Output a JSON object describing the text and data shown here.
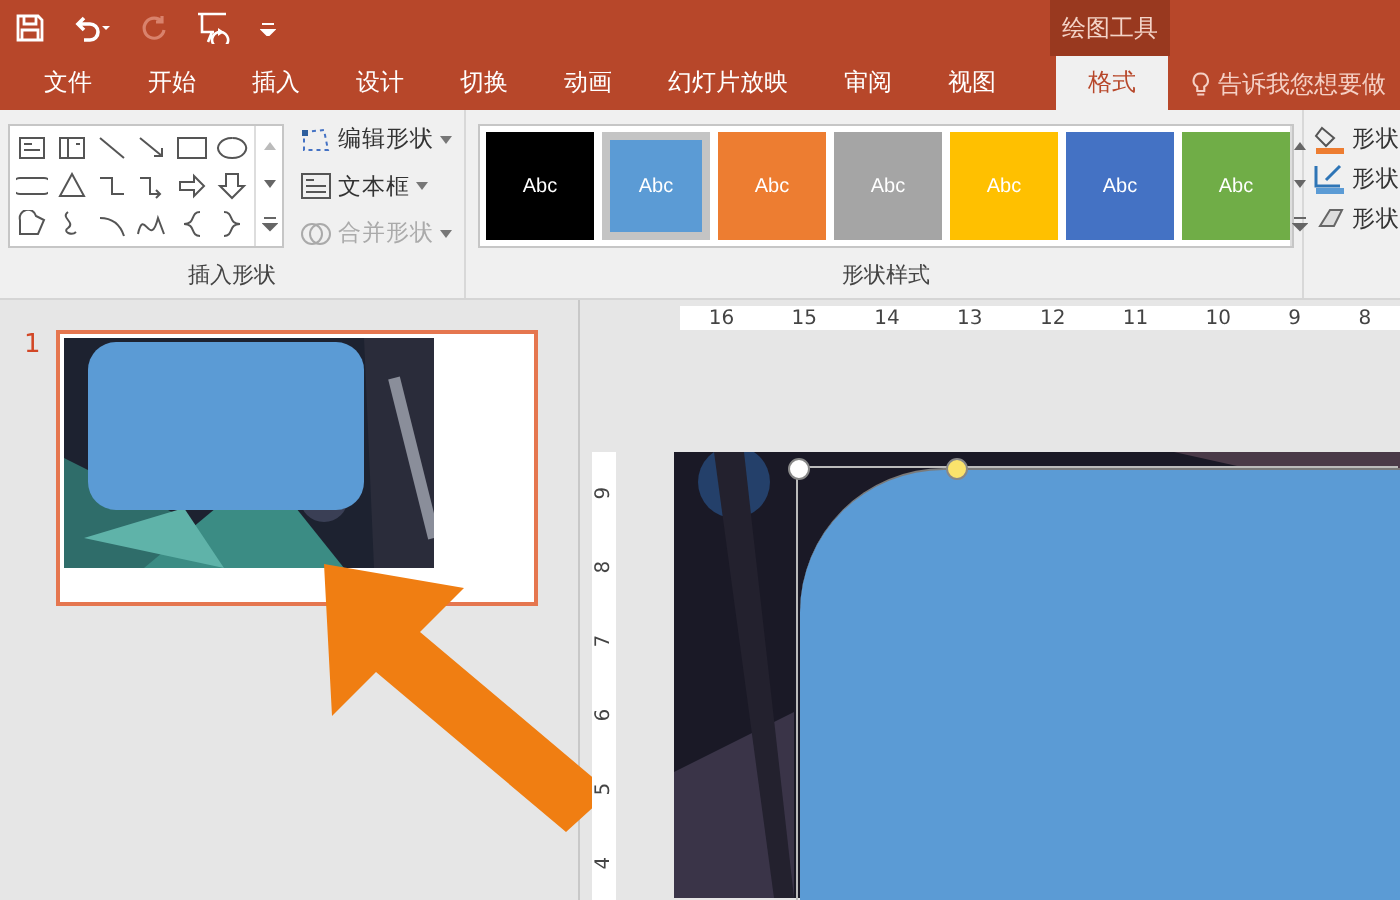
{
  "title_bar": {
    "context_label": "绘图工具"
  },
  "tabs": [
    {
      "label": "文件",
      "selected": false
    },
    {
      "label": "开始",
      "selected": false
    },
    {
      "label": "插入",
      "selected": false
    },
    {
      "label": "设计",
      "selected": false
    },
    {
      "label": "切换",
      "selected": false
    },
    {
      "label": "动画",
      "selected": false
    },
    {
      "label": "幻灯片放映",
      "selected": false
    },
    {
      "label": "审阅",
      "selected": false
    },
    {
      "label": "视图",
      "selected": false
    },
    {
      "label": "格式",
      "selected": true
    }
  ],
  "tell_me": {
    "placeholder": "告诉我您想要做"
  },
  "insert_shapes": {
    "label": "插入形状",
    "commands": [
      {
        "kind": "edit",
        "label": "编辑形状",
        "disabled": false
      },
      {
        "kind": "textbox",
        "label": "文本框",
        "disabled": false
      },
      {
        "kind": "merge",
        "label": "合并形状",
        "disabled": true
      }
    ]
  },
  "shape_styles": {
    "label": "形状样式",
    "styles": [
      {
        "label": "Abc",
        "color": "#000000",
        "selected": false
      },
      {
        "label": "Abc",
        "color": "#5b9bd5",
        "selected": true
      },
      {
        "label": "Abc",
        "color": "#ed7d31",
        "selected": false
      },
      {
        "label": "Abc",
        "color": "#a5a5a5",
        "selected": false
      },
      {
        "label": "Abc",
        "color": "#ffc000",
        "selected": false
      },
      {
        "label": "Abc",
        "color": "#4472c4",
        "selected": false
      },
      {
        "label": "Abc",
        "color": "#70ad47",
        "selected": false
      }
    ]
  },
  "shape_format": [
    {
      "kind": "fill",
      "label": "形状"
    },
    {
      "kind": "outline",
      "label": "形状"
    },
    {
      "kind": "effects",
      "label": "形状"
    }
  ],
  "slides": [
    {
      "number": "1",
      "selected": true
    }
  ],
  "horizontal_ruler": [
    "16",
    "15",
    "14",
    "13",
    "12",
    "11",
    "10",
    "9",
    "8"
  ],
  "vertical_ruler": [
    "9",
    "8",
    "7",
    "6",
    "5",
    "4"
  ]
}
